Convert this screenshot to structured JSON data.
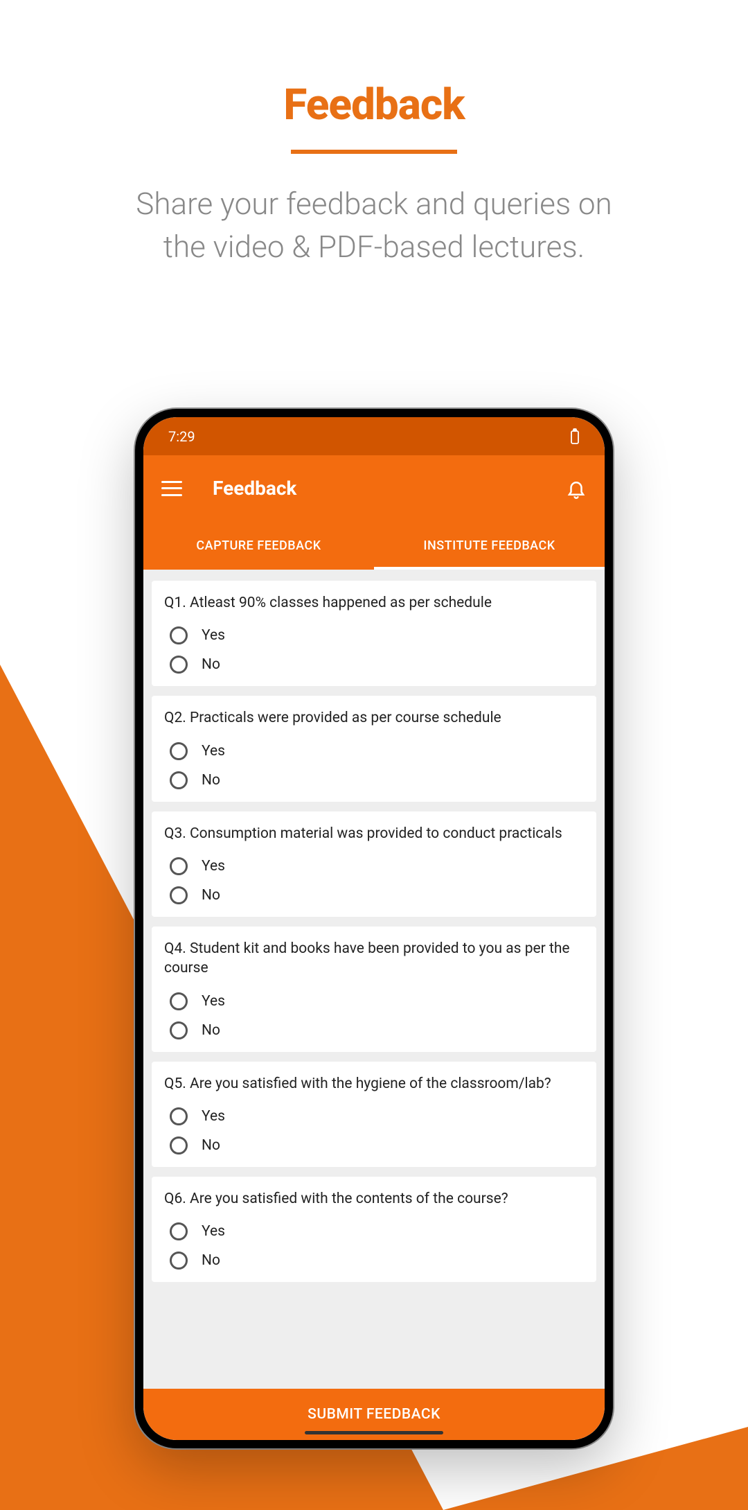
{
  "page": {
    "title": "Feedback",
    "subtitle_line1": "Share your feedback and queries on",
    "subtitle_line2": "the video & PDF-based lectures."
  },
  "status": {
    "time": "7:29"
  },
  "app_bar": {
    "title": "Feedback"
  },
  "tabs": {
    "capture": "CAPTURE FEEDBACK",
    "institute": "INSTITUTE FEEDBACK"
  },
  "questions": [
    {
      "q": "Q1. Atleast 90% classes happened as per schedule",
      "yes": "Yes",
      "no": "No"
    },
    {
      "q": "Q2. Practicals were provided as per course schedule",
      "yes": "Yes",
      "no": "No"
    },
    {
      "q": "Q3. Consumption material was provided to conduct practicals",
      "yes": "Yes",
      "no": "No"
    },
    {
      "q": "Q4. Student kit and books have been provided to you as per the course",
      "yes": "Yes",
      "no": "No"
    },
    {
      "q": "Q5. Are you satisfied with the hygiene of the classroom/lab?",
      "yes": "Yes",
      "no": "No"
    },
    {
      "q": "Q6. Are you satisfied with the contents of the course?",
      "yes": "Yes",
      "no": "No"
    }
  ],
  "submit": {
    "label": "SUBMIT FEEDBACK"
  }
}
